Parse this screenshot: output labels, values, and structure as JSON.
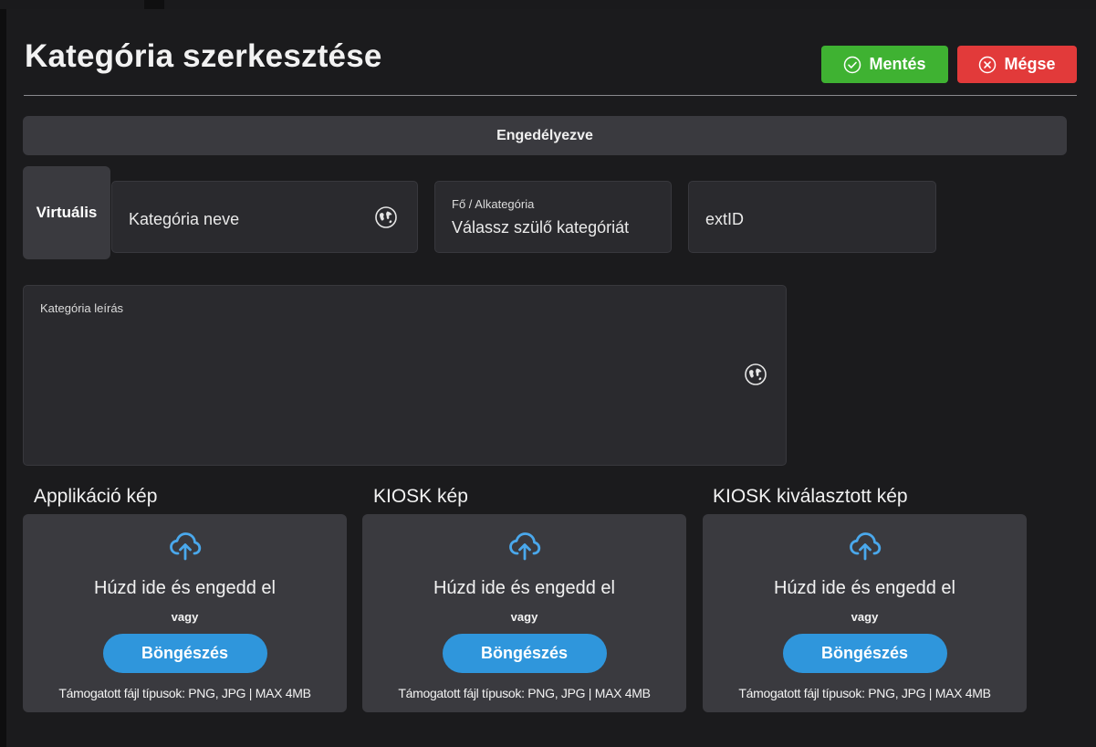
{
  "header": {
    "title": "Kategória szerkesztése",
    "save_label": "Mentés",
    "cancel_label": "Mégse"
  },
  "toggles": {
    "enabled_label": "Engedélyezve",
    "virtual_label": "Virtuális"
  },
  "fields": {
    "name_placeholder": "Kategória neve",
    "parent_label": "Fő / Alkategória",
    "parent_placeholder": "Válassz szülő kategóriát",
    "extid_placeholder": "extID",
    "description_label": "Kategória leírás"
  },
  "uploads": [
    {
      "label": "Applikáció kép",
      "drop_text": "Húzd ide és engedd el",
      "or_text": "vagy",
      "browse_label": "Böngészés",
      "hint": "Támogatott fájl típusok: PNG, JPG | MAX 4MB"
    },
    {
      "label": "KIOSK kép",
      "drop_text": "Húzd ide és engedd el",
      "or_text": "vagy",
      "browse_label": "Böngészés",
      "hint": "Támogatott fájl típusok: PNG, JPG | MAX 4MB"
    },
    {
      "label": "KIOSK kiválasztott kép",
      "drop_text": "Húzd ide és engedd el",
      "or_text": "vagy",
      "browse_label": "Böngészés",
      "hint": "Támogatott fájl típusok: PNG, JPG | MAX 4MB"
    }
  ],
  "icons": {
    "save": "check-circle-icon",
    "cancel": "x-circle-icon",
    "translate": "globe-icon",
    "upload": "cloud-upload-icon"
  },
  "colors": {
    "save": "#3fb232",
    "cancel": "#e23a3a",
    "browse": "#2f96dc",
    "upload_icon": "#4aa8ec"
  }
}
